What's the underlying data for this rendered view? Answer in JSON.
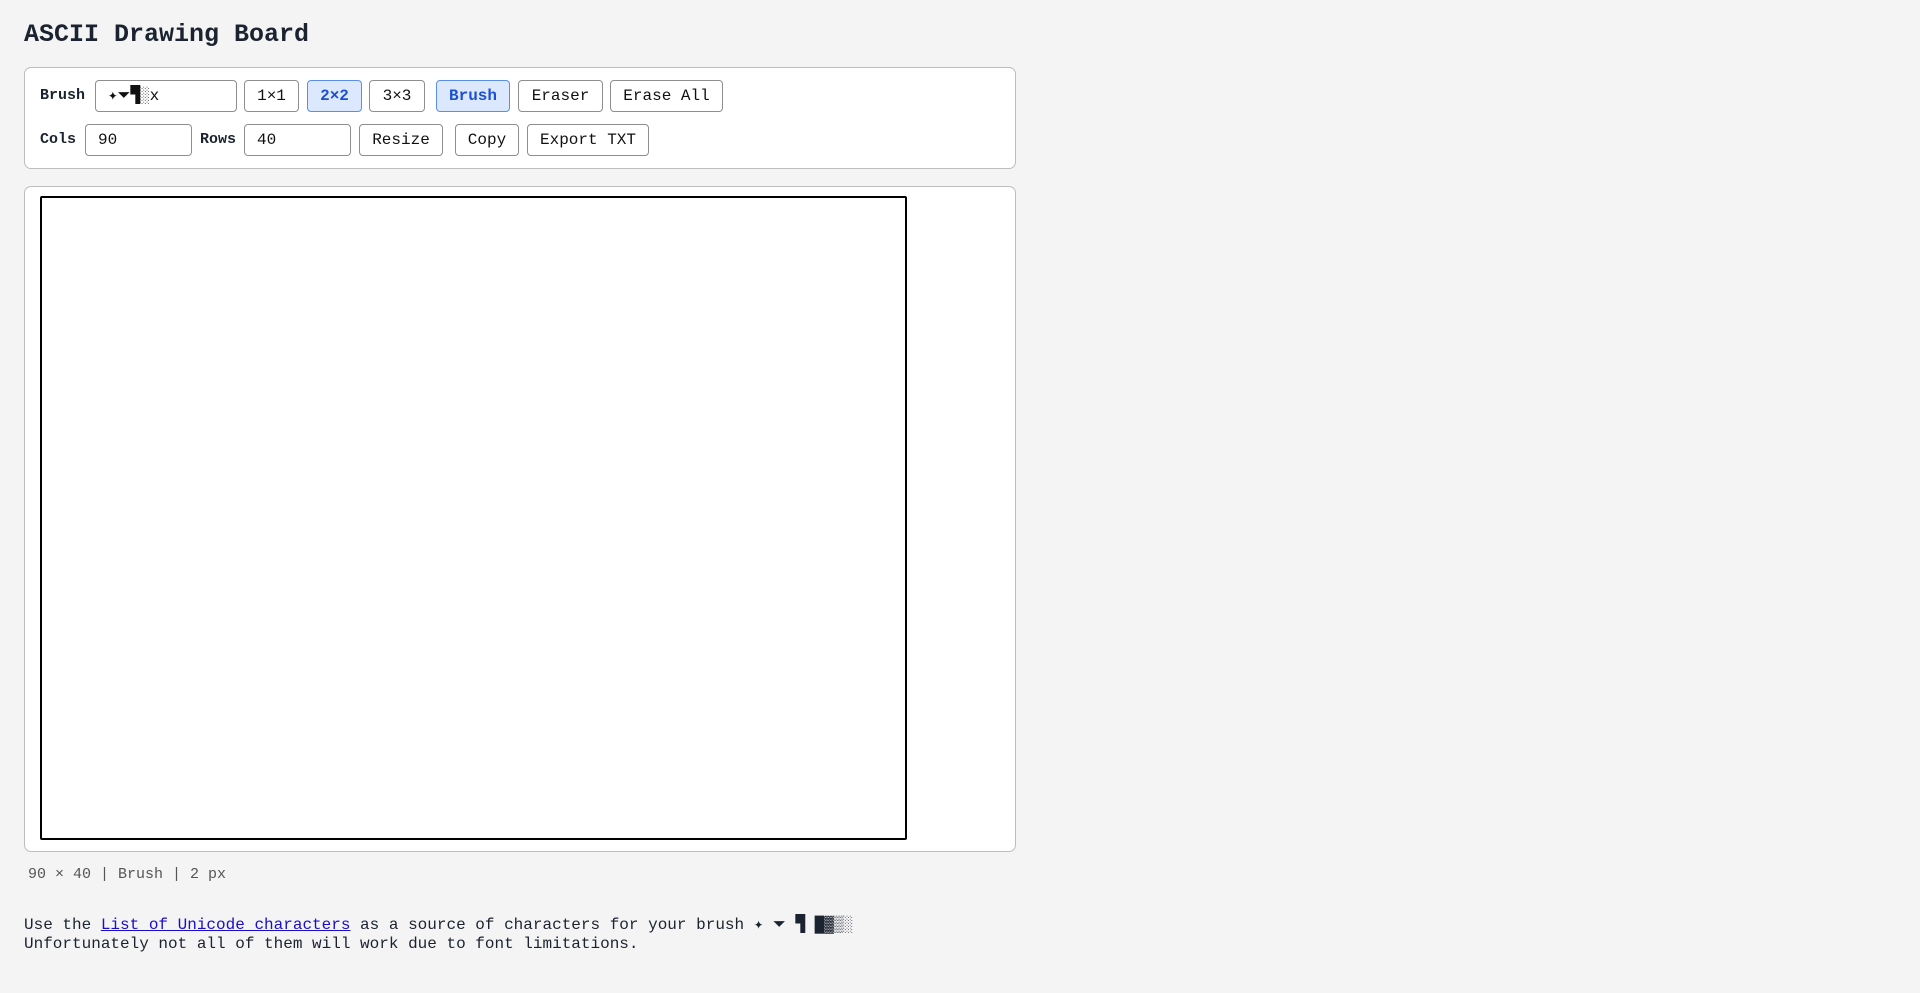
{
  "title": "ASCII Drawing Board",
  "toolbar": {
    "brush_label": "Brush",
    "brush_value": "✦⏷▜░x",
    "sizes": [
      "1×1",
      "2×2",
      "3×3"
    ],
    "active_size": "2×2",
    "brush_button": "Brush",
    "eraser_button": "Eraser",
    "erase_all_button": "Erase All",
    "cols_label": "Cols",
    "cols_value": "90",
    "rows_label": "Rows",
    "rows_value": "40",
    "resize_button": "Resize",
    "copy_button": "Copy",
    "export_button": "Export TXT"
  },
  "status": "90 × 40 | Brush | 2 px",
  "help": {
    "prefix": "Use the ",
    "link": "List of Unicode characters",
    "suffix": " as a source of characters for your brush ✦ ⏷ ▜ █▓▒░",
    "line2": "Unfortunately not all of them will work due to font limitations."
  }
}
